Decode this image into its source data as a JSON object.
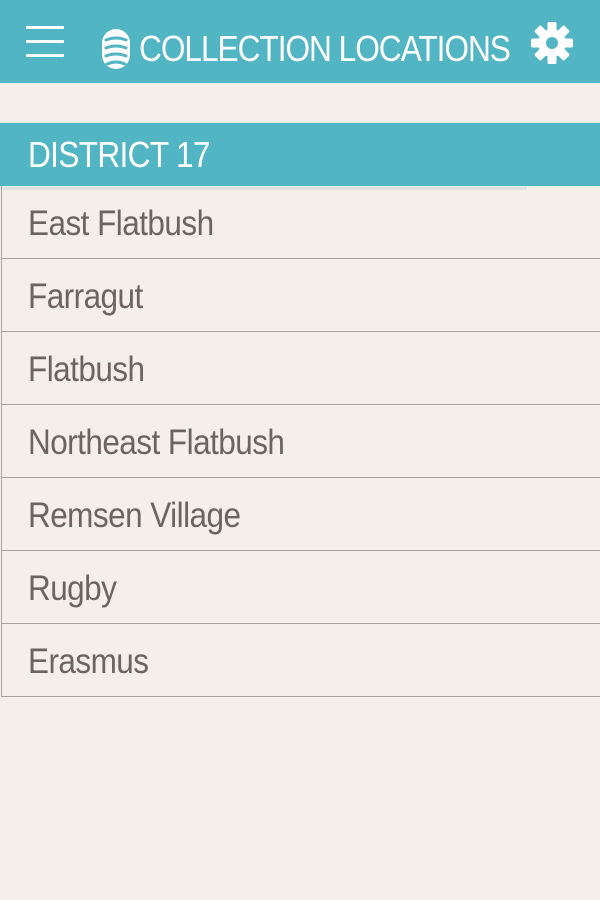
{
  "app_bar": {
    "title": "COLLECTION LOCATIONS",
    "menu_icon": "hamburger-menu-icon",
    "logo_icon": "collection-bin-icon",
    "settings_icon": "gear-icon",
    "background_color": "#51b5c4",
    "text_color": "#ffffff"
  },
  "district": {
    "title": "DISTRICT 17",
    "background_color": "#51b5c4"
  },
  "locations": [
    {
      "label": "East Flatbush"
    },
    {
      "label": "Farragut"
    },
    {
      "label": "Flatbush"
    },
    {
      "label": "Northeast Flatbush"
    },
    {
      "label": "Remsen Village"
    },
    {
      "label": "Rugby"
    },
    {
      "label": "Erasmus"
    }
  ],
  "colors": {
    "page_background": "#f4efe9",
    "item_text": "#6b6561",
    "divider": "#a8a19c"
  }
}
